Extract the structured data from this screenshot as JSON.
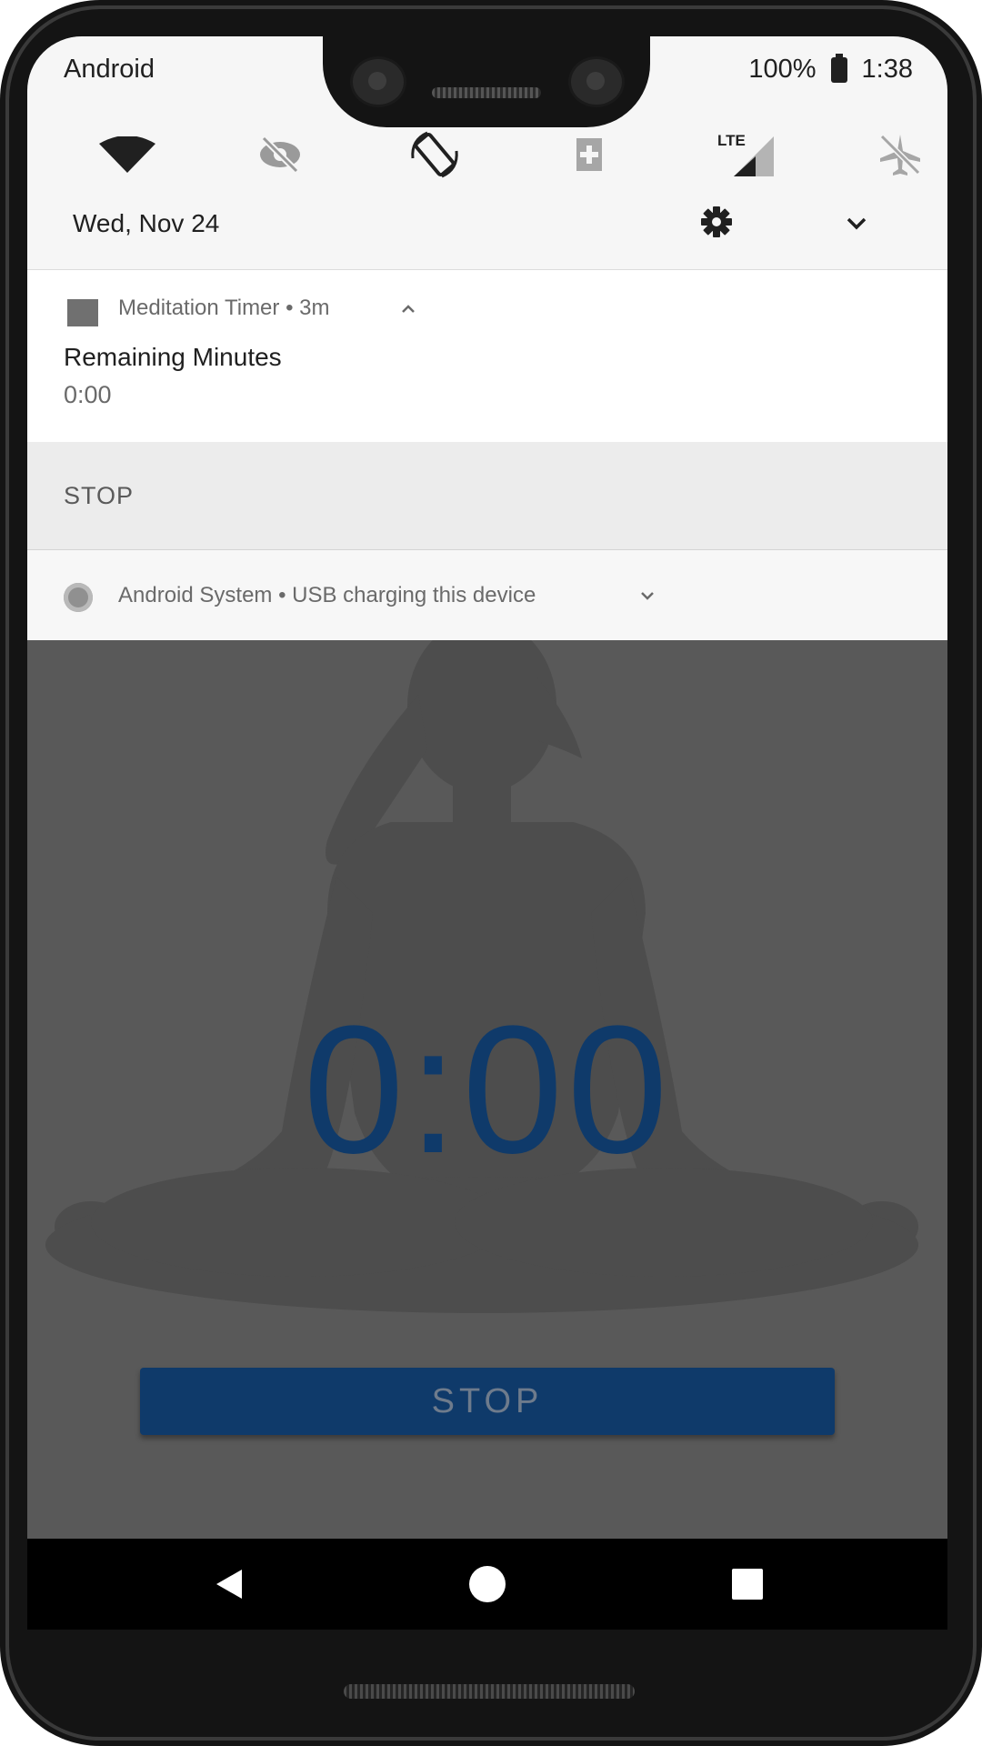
{
  "status_bar": {
    "carrier": "Android",
    "battery": "100%",
    "time": "1:38"
  },
  "quick_settings": {
    "icons": [
      "wifi-icon",
      "data-saver-off-icon",
      "auto-rotate-icon",
      "battery-saver-icon",
      "lte-signal-icon",
      "airplane-mode-icon"
    ],
    "lte_label": "LTE",
    "date": "Wed, Nov 24"
  },
  "notifications": [
    {
      "app": "Meditation Timer",
      "separator": "•",
      "age": "3m",
      "title": "Remaining Minutes",
      "text": "0:00",
      "action": "STOP"
    },
    {
      "app": "Android System",
      "separator": "•",
      "text": "USB charging this device"
    }
  ],
  "app": {
    "timer": "0:00",
    "stop_label": "STOP"
  },
  "colors": {
    "accent": "#0f3a6a",
    "app_background": "#595959",
    "shade_background": "#f6f6f6"
  }
}
